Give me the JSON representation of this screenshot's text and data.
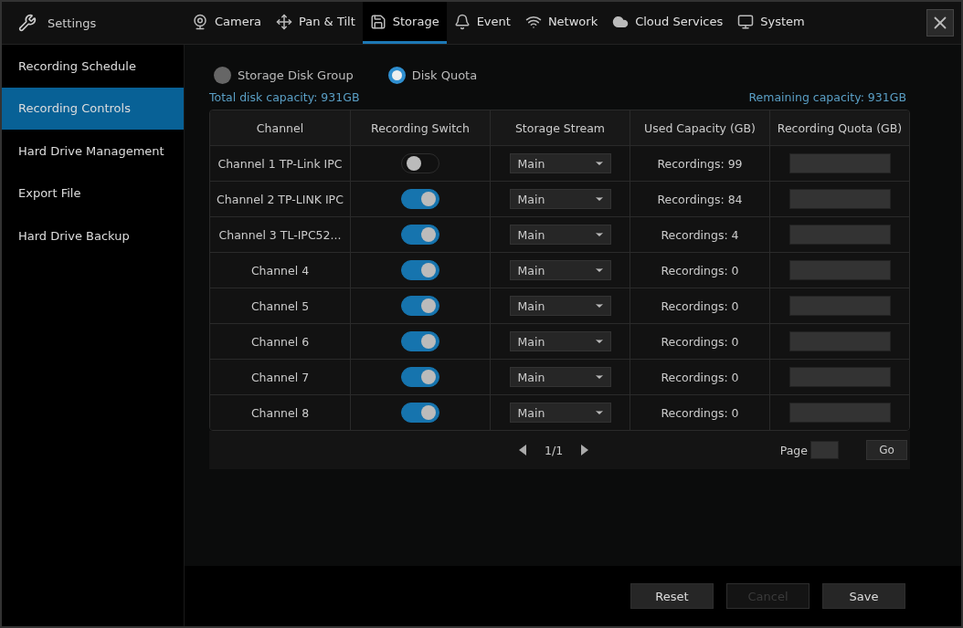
{
  "header": {
    "title": "Settings",
    "tabs": [
      {
        "label": "Camera",
        "selected": false
      },
      {
        "label": "Pan & Tilt",
        "selected": false
      },
      {
        "label": "Storage",
        "selected": true
      },
      {
        "label": "Event",
        "selected": false
      },
      {
        "label": "Network",
        "selected": false
      },
      {
        "label": "Cloud Services",
        "selected": false
      },
      {
        "label": "System",
        "selected": false
      }
    ]
  },
  "sidebar": {
    "items": [
      {
        "label": "Recording Schedule",
        "selected": false
      },
      {
        "label": "Recording Controls",
        "selected": true
      },
      {
        "label": "Hard Drive Management",
        "selected": false
      },
      {
        "label": "Export File",
        "selected": false
      },
      {
        "label": "Hard Drive Backup",
        "selected": false
      }
    ]
  },
  "mode": {
    "options": [
      {
        "label": "Storage Disk Group",
        "selected": false
      },
      {
        "label": "Disk Quota",
        "selected": true
      }
    ]
  },
  "total_capacity": "Total disk capacity: 931GB",
  "remaining_capacity": "Remaining capacity: 931GB",
  "table": {
    "columns": [
      "Channel",
      "Recording Switch",
      "Storage Stream",
      "Used Capacity (GB)",
      "Recording Quota (GB)"
    ],
    "rows": [
      {
        "channel": "Channel 1 TP-Link IPC",
        "on": false,
        "stream": "Main",
        "used": "Recordings: 99"
      },
      {
        "channel": "Channel 2 TP-LINK IPC",
        "on": true,
        "stream": "Main",
        "used": "Recordings: 84"
      },
      {
        "channel": "Channel 3 TL-IPC52...",
        "on": true,
        "stream": "Main",
        "used": "Recordings: 4"
      },
      {
        "channel": "Channel 4",
        "on": true,
        "stream": "Main",
        "used": "Recordings: 0"
      },
      {
        "channel": "Channel 5",
        "on": true,
        "stream": "Main",
        "used": "Recordings: 0"
      },
      {
        "channel": "Channel 6",
        "on": true,
        "stream": "Main",
        "used": "Recordings: 0"
      },
      {
        "channel": "Channel 7",
        "on": true,
        "stream": "Main",
        "used": "Recordings: 0"
      },
      {
        "channel": "Channel 8",
        "on": true,
        "stream": "Main",
        "used": "Recordings: 0"
      }
    ]
  },
  "pagination": {
    "page": "1/1",
    "page_label": "Page",
    "go": "Go"
  },
  "buttons": [
    {
      "label": "Reset",
      "disabled": false
    },
    {
      "label": "Cancel",
      "disabled": true
    },
    {
      "label": "Save",
      "disabled": false
    }
  ]
}
